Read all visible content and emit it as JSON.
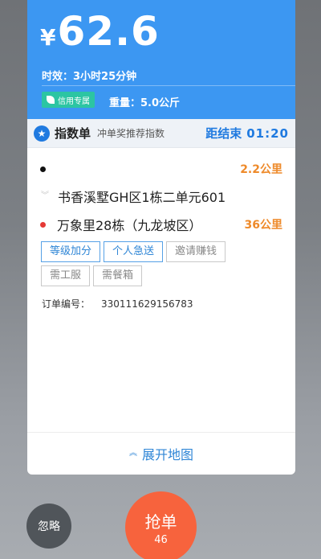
{
  "price": {
    "currency": "¥",
    "amount": "62.6"
  },
  "time_text": "时效：3小时25分钟",
  "credit_tag": "信用专属",
  "weight_text": "重量：5.0公斤",
  "index_bar": {
    "title": "指数单",
    "subtitle": "冲单奖推荐指数",
    "countdown_label": "距结束",
    "countdown": "01:20"
  },
  "pickup": {
    "address": "",
    "distance": "2.2公里",
    "dot_color": "#111111"
  },
  "waypoint": {
    "address": "书香溪墅GH区1栋二单元601"
  },
  "dropoff": {
    "address": "万象里28栋（九龙坡区）",
    "distance": "36公里",
    "dot_color": "#e53935"
  },
  "tags": [
    {
      "label": "等级加分",
      "style": "blue"
    },
    {
      "label": "个人急送",
      "style": "blue"
    },
    {
      "label": "邀请赚钱",
      "style": "gray"
    },
    {
      "label": "需工服",
      "style": "gray"
    },
    {
      "label": "需餐箱",
      "style": "gray"
    }
  ],
  "order": {
    "label": "订单编号：",
    "number": "330111629156783"
  },
  "expand_map": "展开地图",
  "buttons": {
    "ignore": "忽略",
    "grab": "抢单",
    "grab_count": "46"
  },
  "colors": {
    "header": "#3c97f2",
    "accent": "#1f7ae0",
    "distance": "#ee8a2a",
    "grab": "#f7633d"
  },
  "icons": {
    "credit": "leaf-icon",
    "index": "badge-icon",
    "expand": "chevron-up-icon"
  }
}
